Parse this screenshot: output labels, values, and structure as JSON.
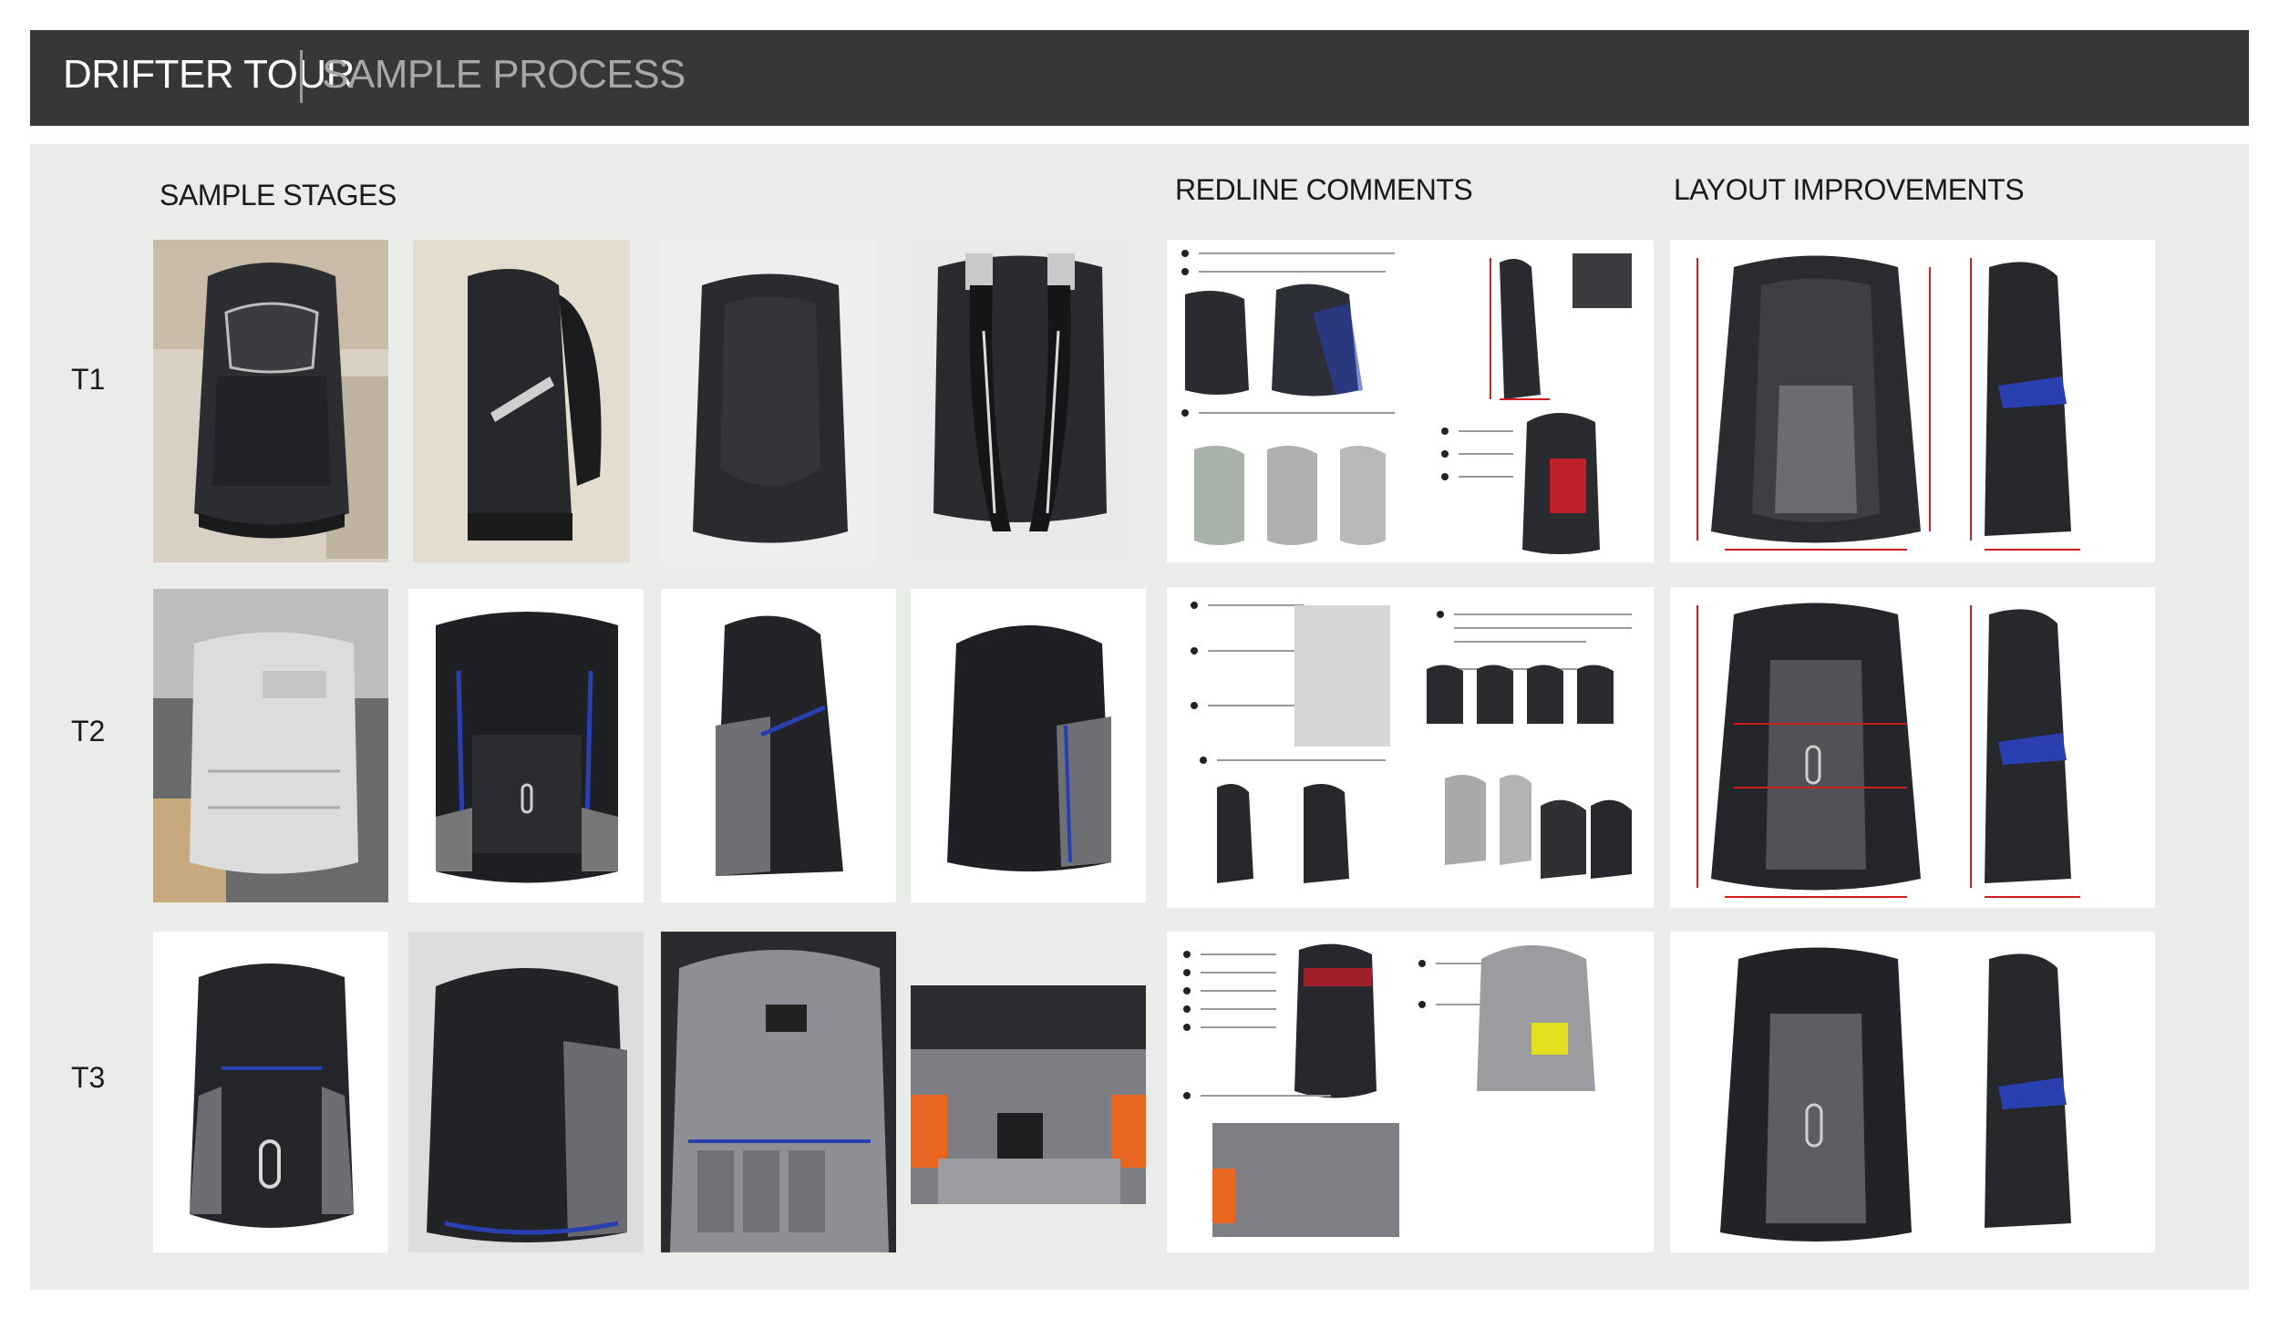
{
  "header": {
    "title": "DRIFTER TOUR",
    "subtitle": "SAMPLE PROCESS"
  },
  "sections": {
    "sample_stages": "SAMPLE STAGES",
    "redline_comments": "REDLINE COMMENTS",
    "layout_improvements": "LAYOUT IMPROVEMENTS"
  },
  "rows": [
    {
      "label": "T1"
    },
    {
      "label": "T2"
    },
    {
      "label": "T3"
    }
  ],
  "colors": {
    "header_bg": "#373737",
    "panel_bg": "#eaecea",
    "accent_blue": "#2a3fb0",
    "redline": "#d11f1f"
  },
  "icons": {
    "photo": "backpack-photo",
    "drawing": "backpack-technical-drawing"
  }
}
